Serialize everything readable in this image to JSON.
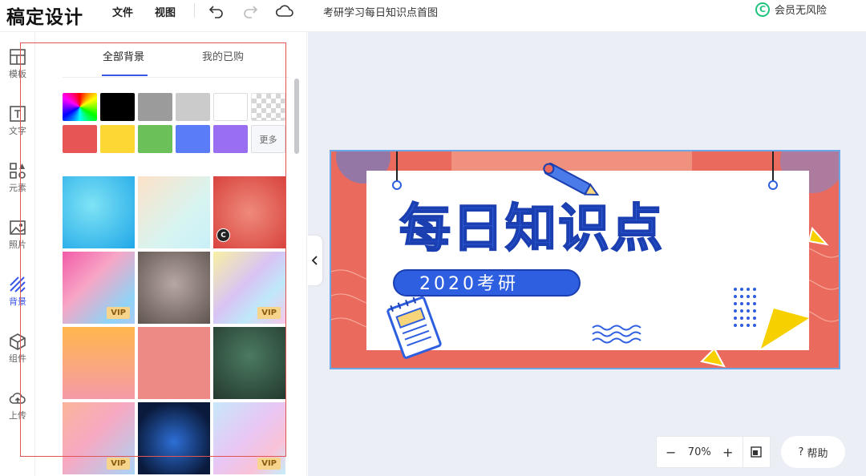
{
  "app": {
    "logo": "稿定设计",
    "doc_title": "考研学习每日知识点首图",
    "vip_label": "会员无风险",
    "c_mark": "C"
  },
  "menu": {
    "file": "文件",
    "view": "视图"
  },
  "rail": [
    {
      "label": "模板",
      "icon": "template-icon"
    },
    {
      "label": "文字",
      "icon": "text-icon"
    },
    {
      "label": "元素",
      "icon": "elements-icon"
    },
    {
      "label": "照片",
      "icon": "photo-icon"
    },
    {
      "label": "背景",
      "icon": "background-icon",
      "active": true
    },
    {
      "label": "组件",
      "icon": "component-icon"
    },
    {
      "label": "上传",
      "icon": "upload-icon"
    }
  ],
  "panel": {
    "tabs": [
      {
        "label": "全部背景",
        "active": true
      },
      {
        "label": "我的已购"
      }
    ],
    "more_label": "更多",
    "swatches": [
      "rainbow",
      "#000000",
      "#9b9b9b",
      "#cbcbcb",
      "#ffffff",
      "transparent",
      "#e85555",
      "#fdd835",
      "#6cc05a",
      "#5b7cf7",
      "#9a6ef0"
    ],
    "vip_tag": "VIP",
    "c_tag": "C"
  },
  "artboard": {
    "headline": "每日知识点",
    "subtitle": "2020考研"
  },
  "zoom": {
    "minus": "−",
    "value": "70%",
    "plus": "+"
  },
  "help": {
    "icon": "?",
    "label": "帮助"
  }
}
